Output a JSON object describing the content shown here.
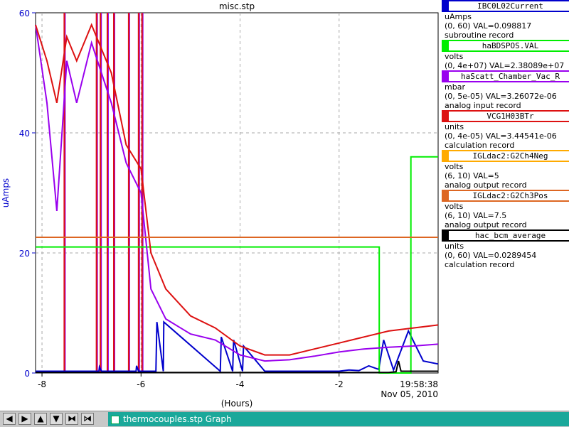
{
  "chart_data": {
    "type": "line",
    "title": "misc.stp",
    "xlabel": "(Hours)",
    "ylabel": "uAmps",
    "xlim": [
      -8.13,
      0
    ],
    "ylim": [
      0,
      60
    ],
    "x_ticks": [
      -8,
      -6,
      -4,
      -2
    ],
    "x_tick_labels": [
      "-8",
      "-6",
      "-4",
      "-2"
    ],
    "y_ticks": [
      0,
      20,
      40,
      60
    ],
    "y_tick_labels": [
      "0",
      "20",
      "40",
      "60"
    ],
    "timestamp": "19:58:38",
    "date": "Nov 05, 2010",
    "grid": true,
    "series": [
      {
        "name": "IBC0L02Current",
        "color": "#0000cc",
        "x": [
          -8.13,
          -6.85,
          -6.84,
          -6.8,
          -6.79,
          -6.1,
          -6.09,
          -6.05,
          -6.0,
          -5.7,
          -5.68,
          -5.55,
          -5.54,
          -4.4,
          -4.38,
          -4.15,
          -4.13,
          -3.95,
          -3.93,
          -3.5,
          -2.0,
          -1.8,
          -1.6,
          -1.4,
          -1.2,
          -1.1,
          -0.9,
          -0.6,
          -0.3,
          0
        ],
        "values": [
          0.3,
          0.3,
          1,
          0.3,
          0.3,
          0.3,
          1.2,
          0.3,
          0.3,
          0.3,
          8.5,
          0.3,
          8.5,
          0.3,
          6.0,
          0.3,
          5.5,
          0.3,
          4.5,
          0.3,
          0.3,
          0.5,
          0.4,
          1.2,
          0.6,
          5.5,
          0.5,
          7.0,
          2.0,
          1.5
        ]
      },
      {
        "name": "haBDSPOS.VAL",
        "color": "#00ee00",
        "x": [
          -8.13,
          -1.19,
          -1.19,
          -0.59,
          -0.59,
          -0.55,
          -0.55,
          0
        ],
        "values": [
          21,
          21,
          0,
          0,
          0,
          0,
          36,
          36
        ]
      },
      {
        "name": "haScatt_Chamber_Vac_R",
        "color": "#9900ee",
        "x": [
          -8.13,
          -7.9,
          -7.7,
          -7.5,
          -7.3,
          -7.0,
          -6.6,
          -6.3,
          -6.0,
          -5.8,
          -5.5,
          -5.0,
          -4.5,
          -4.0,
          -3.5,
          -3.0,
          -2.5,
          -2.0,
          -1.5,
          -1.0,
          -0.5,
          0
        ],
        "values": [
          58,
          45,
          27,
          52,
          45,
          55,
          45,
          35,
          30,
          14,
          9,
          6.5,
          5.5,
          3.0,
          2.0,
          2.2,
          2.8,
          3.5,
          4.0,
          4.3,
          4.5,
          4.8
        ]
      },
      {
        "name": "VCG1H03BTr",
        "color": "#dd1111",
        "x": [
          -8.13,
          -7.9,
          -7.7,
          -7.5,
          -7.3,
          -7.0,
          -6.6,
          -6.3,
          -6.0,
          -5.8,
          -5.5,
          -5.0,
          -4.5,
          -4.0,
          -3.5,
          -3.0,
          -2.5,
          -2.0,
          -1.5,
          -1.0,
          -0.5,
          0
        ],
        "values": [
          58,
          52,
          45,
          56,
          52,
          58,
          50,
          38,
          34,
          20,
          14,
          9.5,
          7.5,
          4.5,
          3.0,
          3.0,
          4.0,
          5.0,
          6.0,
          7.0,
          7.5,
          8.0
        ]
      },
      {
        "name": "IGLdac2:G2Ch4Neg",
        "color": "#ffaa00",
        "x": [
          -8.13,
          0
        ],
        "values": [
          22.6,
          22.6
        ]
      },
      {
        "name": "IGLdac2:G2Ch3Pos",
        "color": "#dd6622",
        "x": [
          -8.13,
          0
        ],
        "values": [
          22.6,
          22.6
        ]
      },
      {
        "name": "hac_bcm_average",
        "color": "#000000",
        "x": [
          -8.13,
          -1.0,
          -0.85,
          -0.8,
          -0.75,
          0
        ],
        "values": [
          0.1,
          0.1,
          0.2,
          2.0,
          0.3,
          0.3
        ]
      }
    ],
    "spikes": {
      "color": "#dd1111",
      "purple": "#9900ee",
      "x": [
        -7.55,
        -6.9,
        -6.82,
        -6.68,
        -6.55,
        -6.25,
        -6.05,
        -5.98
      ]
    }
  },
  "legend": [
    {
      "name": "IBC0L02Current",
      "color": "#0000cc",
      "units": "uAmps",
      "range_val": "(0, 60) VAL=0.098817",
      "record": "subroutine record"
    },
    {
      "name": "haBDSPOS.VAL",
      "color": "#00ee00",
      "units": "volts",
      "range_val": "(0, 4e+07) VAL=2.38089e+07",
      "record": ""
    },
    {
      "name": "haScatt_Chamber_Vac_R",
      "color": "#9900ee",
      "units": "mbar",
      "range_val": "(0, 5e-05) VAL=3.26072e-06",
      "record": "analog input record"
    },
    {
      "name": "VCG1H03BTr",
      "color": "#dd1111",
      "units": "units",
      "range_val": "(0, 4e-05) VAL=3.44541e-06",
      "record": "calculation record"
    },
    {
      "name": "IGLdac2:G2Ch4Neg",
      "color": "#ffaa00",
      "units": "volts",
      "range_val": "(6, 10) VAL=5",
      "record": "analog output record"
    },
    {
      "name": "IGLdac2:G2Ch3Pos",
      "color": "#dd6622",
      "units": "volts",
      "range_val": "(6, 10) VAL=7.5",
      "record": "analog output record"
    },
    {
      "name": "hac_bcm_average",
      "color": "#000000",
      "units": "units",
      "range_val": "(0, 60) VAL=0.0289454",
      "record": "calculation record"
    }
  ],
  "taskbar": {
    "buttons": [
      {
        "icon": "arrow-left-icon",
        "glyph": "◀"
      },
      {
        "icon": "arrow-right-icon",
        "glyph": "▶"
      },
      {
        "icon": "arrow-up-icon",
        "glyph": "▲"
      },
      {
        "icon": "arrow-down-icon",
        "glyph": "▼"
      },
      {
        "icon": "collapse-icon",
        "glyph": "⧓"
      },
      {
        "icon": "expand-icon",
        "glyph": "⧒"
      }
    ],
    "task_label": "thermocouples.stp Graph"
  }
}
